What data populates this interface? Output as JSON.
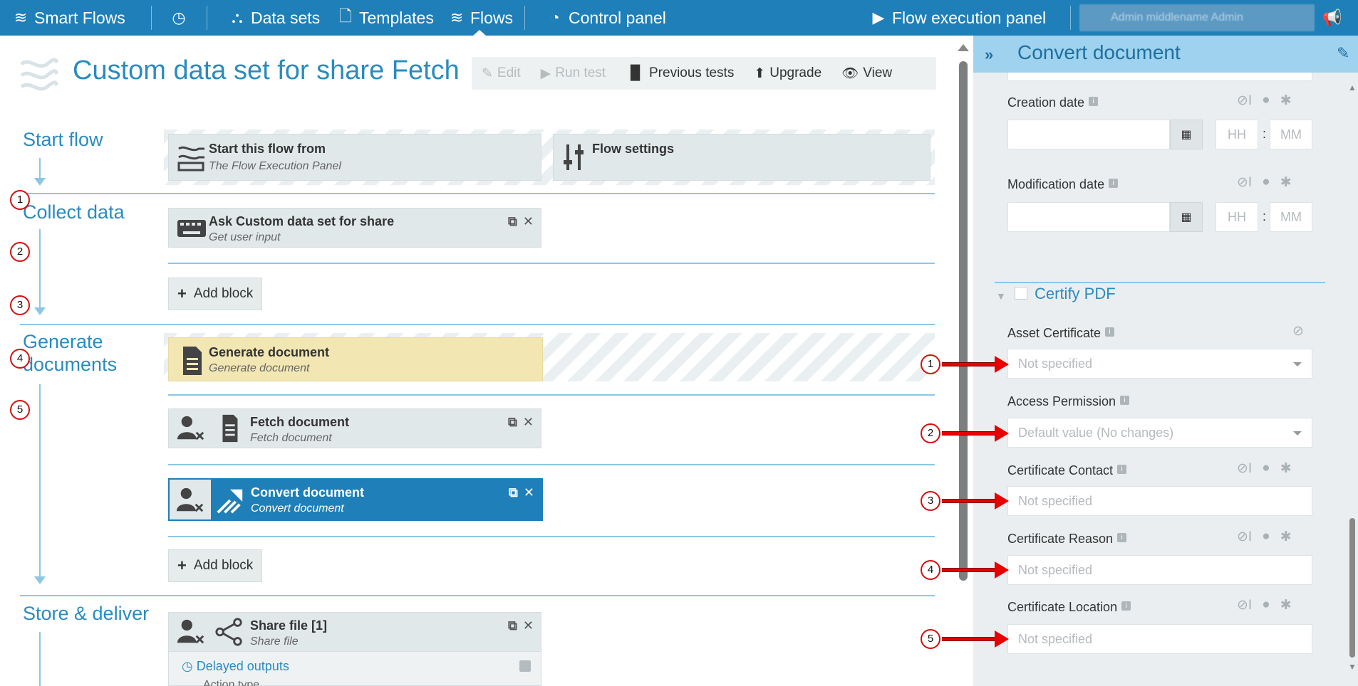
{
  "topbar": {
    "brand": "Smart Flows",
    "nav": [
      "Data sets",
      "Templates",
      "Flows",
      "Control panel"
    ],
    "execution_panel": "Flow execution panel",
    "user": "Admin middlename Admin"
  },
  "header": {
    "title": "Custom data set for share Fetch",
    "toolbar": [
      "Edit",
      "Run test",
      "Previous tests",
      "Upgrade",
      "View"
    ]
  },
  "sections": {
    "start": "Start flow",
    "collect": "Collect data",
    "generate": "Generate documents",
    "store": "Store & deliver"
  },
  "blocks": {
    "start_from": {
      "title": "Start this flow from",
      "subtitle": "The Flow Execution Panel"
    },
    "flow_settings": {
      "title": "Flow settings"
    },
    "ask_custom": {
      "title": "Ask Custom data set for share",
      "subtitle": "Get user input"
    },
    "generate_doc": {
      "title": "Generate document",
      "subtitle": "Generate document"
    },
    "fetch_doc": {
      "title": "Fetch document",
      "subtitle": "Fetch document"
    },
    "convert_doc": {
      "title": "Convert document",
      "subtitle": "Convert document"
    },
    "share_file": {
      "title": "Share file [1]",
      "subtitle": "Share file"
    },
    "delayed_outputs": "Delayed outputs",
    "action_type": "Action type",
    "add_block": "Add block"
  },
  "callouts": [
    "1",
    "2",
    "3",
    "4",
    "5"
  ],
  "panel": {
    "title": "Convert document",
    "creation_date": "Creation date",
    "modification_date": "Modification date",
    "hh": "HH",
    "mm": "MM",
    "certify": "Certify PDF",
    "fields": [
      {
        "label": "Asset Certificate",
        "value": "Not specified"
      },
      {
        "label": "Access Permission",
        "value": "Default value (No changes)"
      },
      {
        "label": "Certificate Contact",
        "value": "Not specified"
      },
      {
        "label": "Certificate Reason",
        "value": "Not specified"
      },
      {
        "label": "Certificate Location",
        "value": "Not specified"
      }
    ]
  },
  "colors": {
    "brand": "#1f7fb8",
    "accent": "#2a8bbf",
    "selected_block": "#1f7fb8",
    "generate_block": "#f2e6b3",
    "callout": "#d31010",
    "arrow": "#e80000"
  }
}
